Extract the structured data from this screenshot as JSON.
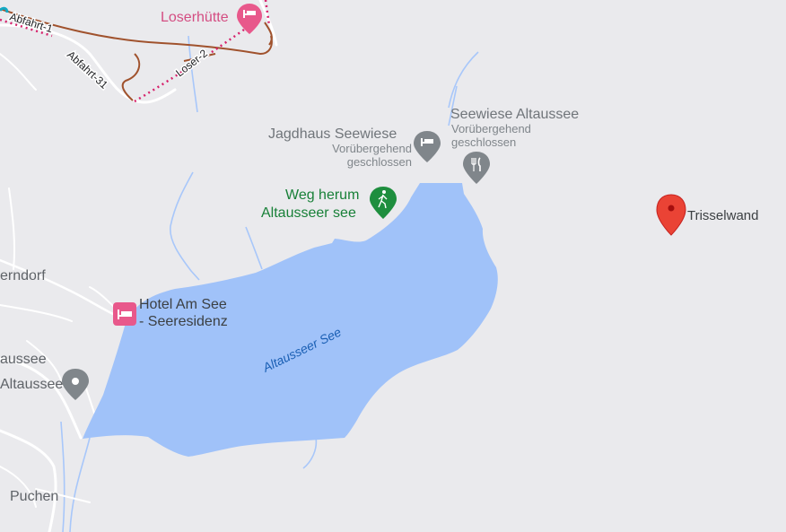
{
  "colors": {
    "water": "#a0c2f9",
    "lake_label": "#1a5fb4",
    "background": "#eaeaed",
    "road": "#ffffff",
    "stream": "#a8c7fa",
    "piste_red": "#a0522d",
    "trail_pink": "#d6226b",
    "lodging_pink": "#e8588b",
    "poi_gray": "#80868b",
    "pin_red": "#ea4335",
    "trail_green": "#1e8e3e"
  },
  "icons": {
    "lodging": "bed-icon",
    "restaurant": "fork-knife-icon",
    "hiking": "hiker-icon",
    "place": "pin-icon",
    "selected": "red-pin-icon"
  },
  "labels": {
    "loserhuette": "Loserhütte",
    "abfahrt1": "Abfahrt-1",
    "abfahrt31": "Abfahrt-31",
    "loser2": "Loser-2",
    "jagdhaus_name": "Jagdhaus Seewiese",
    "jagdhaus_status_1": "Vorübergehend",
    "jagdhaus_status_2": "geschlossen",
    "seewiese_name": "Seewiese Altaussee",
    "seewiese_status_1": "Vorübergehend",
    "seewiese_status_2": "geschlossen",
    "trail_1": "Weg herum",
    "trail_2": "Altausseer see",
    "pin_name": "Trisselwand",
    "lake": "Altausseer See",
    "hotel_1": "Hotel Am See",
    "hotel_2": "- Seeresidenz",
    "town_erndorf": "erndorf",
    "town_aussee": "aussee",
    "town_altaussee": "Altaussee",
    "town_puchen": "Puchen"
  }
}
